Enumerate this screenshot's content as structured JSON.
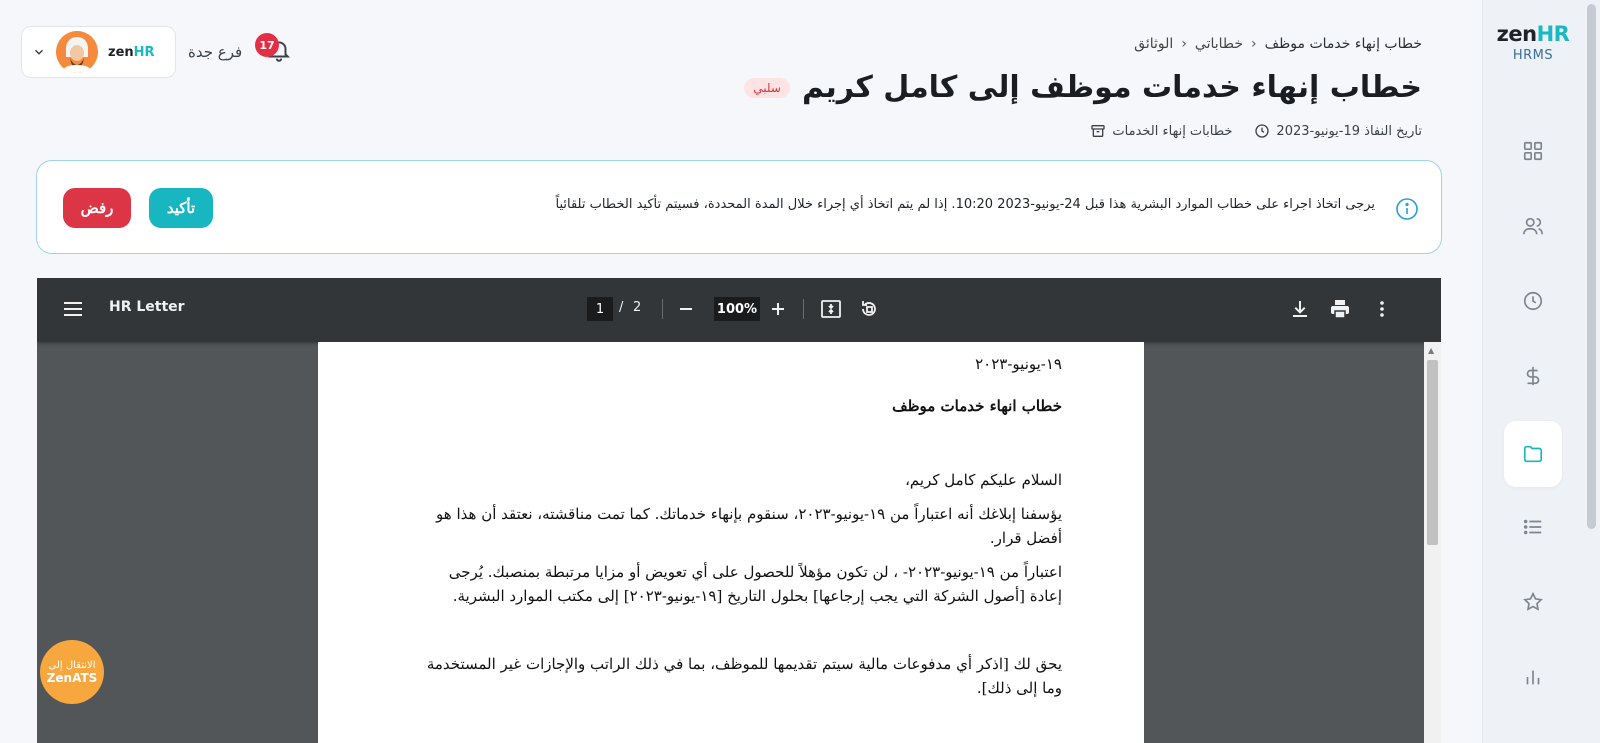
{
  "brand": {
    "logo_zen": "zen",
    "logo_hr": "HR",
    "logo_sub": "HRMS",
    "accent": "#17b6c0"
  },
  "sidebar": {
    "items": [
      {
        "icon": "grid-icon",
        "active": false
      },
      {
        "icon": "users-icon",
        "active": false
      },
      {
        "icon": "clock-icon",
        "active": false
      },
      {
        "icon": "dollar-icon",
        "active": false
      },
      {
        "icon": "folder-icon",
        "active": true
      },
      {
        "icon": "list-icon",
        "active": false
      },
      {
        "icon": "star-icon",
        "active": false
      },
      {
        "icon": "chart-icon",
        "active": false
      }
    ]
  },
  "breadcrumb": {
    "root": "الوثائق",
    "middle": "خطاباتي",
    "current": "خطاب إنهاء خدمات موظف"
  },
  "header": {
    "title": "خطاب إنهاء خدمات موظف إلى كامل كريم",
    "badge": "سلبي",
    "meta_category": "خطابات إنهاء الخدمات",
    "meta_date": "تاريخ النفاذ 19-يونيو-2023"
  },
  "user": {
    "branch": "فرع جدة",
    "notifications": "17",
    "mini_logo_zen": "zen",
    "mini_logo_hr": "HR"
  },
  "alert": {
    "message": "يرجى اتخاذ اجراء على خطاب الموارد البشرية هذا قبل 24-يونيو-2023 10:20. إذا لم يتم اتخاذ أي إجراء خلال المدة المحددة، فسيتم تأكيد الخطاب تلقائياً",
    "confirm_label": "تأكيد",
    "reject_label": "رفض"
  },
  "pdf": {
    "title": "HR Letter",
    "page_current": "1",
    "page_sep": "/",
    "page_total": "2",
    "zoom": "100%"
  },
  "document": {
    "date": "١٩-يونيو-٢٠٢٣",
    "heading": "خطاب انهاء خدمات موظف",
    "greeting": "السلام عليكم كامل كريم،",
    "para1": "يؤسفنا إبلاغك أنه اعتباراً من ١٩-يونيو-٢٠٢٣، سنقوم بإنهاء خدماتك. كما تمت مناقشته، نعتقد أن هذا هو أفضل قرار.",
    "para2": "اعتباراً من ١٩-يونيو-٢٠٢٣- ، لن تكون مؤهلاً للحصول على أي تعويض أو مزايا مرتبطة بمنصبك. يُرجى إعادة [أصول الشركة التي يجب إرجاعها] بحلول التاريخ [١٩-يونيو-٢٠٢٣] إلى مكتب الموارد البشرية.",
    "para3": "يحق لك [اذكر أي مدفوعات مالية سيتم تقديمها للموظف، بما في ذلك الراتب والإجازات غير المستخدمة وما إلى ذلك]."
  },
  "ats": {
    "line1": "الانتقال إلى",
    "line2": "ZenATS"
  }
}
